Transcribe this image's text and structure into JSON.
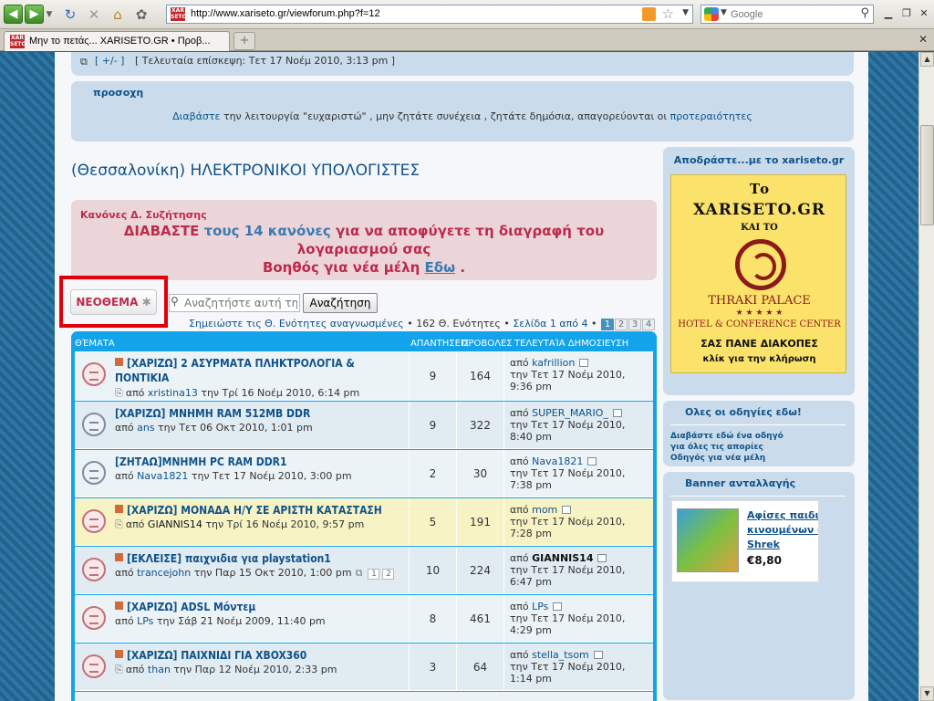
{
  "browser": {
    "url": "http://www.xariseto.gr/viewforum.php?f=12",
    "search_placeholder": "Google",
    "tab_title": "Μην το πετάς... XARISETO.GR • Προβ..."
  },
  "topbar": {
    "toggle": "[ +/- ]",
    "last_visit": "[ Τελευταία επίσκεψη: Τετ 17 Νοέμ 2010, 3:13 pm ]"
  },
  "notice": {
    "title": "προσοχη",
    "link1": "Διαβάστε",
    "middle": " την λειτουργία \"ευχαριστώ\" , μην ζητάτε συνέχεια , ζητάτε δημόσια, απαγορεύονται οι ",
    "link2": "προτεραιότητες"
  },
  "forum_title": "(Θεσσαλονίκη) ΗΛΕΚΤΡΟΝΙΚΟΙ ΥΠΟΛΟΓΙΣΤΕΣ",
  "rules": {
    "heading": "Κανόνες Δ. Συζήτησης",
    "l1a": "ΔΙΑΒΑΣΤΕ ",
    "l1link": "τους 14 κανόνες",
    "l1b": " για να αποφύγετε τη διαγραφή του",
    "l2": "λογαριασμού σας",
    "l3a": "Βοηθός για νέα μέλη ",
    "l3link": "Εδω",
    "l3b": " ."
  },
  "new_topic": {
    "a": "ΝΕΟ",
    "b": "ΘΕΜΑ",
    "star": "✱"
  },
  "forum_search": {
    "placeholder": "Αναζητήστε αυτή τη",
    "button": "Αναζήτηση"
  },
  "pagination": {
    "mark_read": "Σημειώστε τις Θ. Ενότητες αναγνωσμένες",
    "count": " • 162 Θ. Ενότητες • ",
    "page_info": "Σελίδα 1 από 4",
    "sep": " • ",
    "pages": [
      "1",
      "2",
      "3",
      "4"
    ]
  },
  "table_header": {
    "topics": "ΘΈΜΑΤΑ",
    "replies": "ΑΠΑΝΤΗΣΕΙΣ",
    "views": "ΠΡΟΒΟΛΕΣ",
    "last": "ΤΕΛΕΥΤΑΊΑ ΔΗΜΟΣΙΕΥΣΗ"
  },
  "topics": [
    {
      "title": "[ΧΑΡΙΖΩ] 2 ΑΣΥΡΜΑΤΑ ΠΛΗΚΤΡΟΛΟΓΙΑ & ΠΟΝΤΙΚΙΑ",
      "by_prefix": "από ",
      "author": "xristina13",
      "date": " την Τρί 16 Νοέμ 2010, 6:14 pm",
      "replies": "9",
      "views": "164",
      "last_prefix": "από ",
      "last_user": "kafrillion",
      "last_date1": "την Τετ 17 Νοέμ 2010,",
      "last_date2": "9:36 pm"
    },
    {
      "title": "[ΧΑΡΙΖΩ] ΜΝΗΜΗ RAM 512MB DDR",
      "by_prefix": "από ",
      "author": "ans",
      "date": " την Τετ 06 Οκτ 2010, 1:01 pm",
      "replies": "9",
      "views": "322",
      "last_prefix": "από ",
      "last_user": "SUPER_MARIO_",
      "last_date1": "την Τετ 17 Νοέμ 2010,",
      "last_date2": "8:40 pm"
    },
    {
      "title": "[ΖΗΤΑΩ]ΜΝΗΜΗ PC RAM DDR1",
      "by_prefix": "από ",
      "author": "Nava1821",
      "date": " την Τετ 17 Νοέμ 2010, 3:00 pm",
      "replies": "2",
      "views": "30",
      "last_prefix": "από ",
      "last_user": "Nava1821",
      "last_date1": "την Τετ 17 Νοέμ 2010,",
      "last_date2": "7:38 pm"
    },
    {
      "title": "[ΧΑΡΙΖΩ] ΜΟΝΑΔΑ Η/Υ ΣΕ ΑΡΙΣΤΗ ΚΑΤΑΣΤΑΣΗ",
      "by_prefix": "από ",
      "author": "GIANNIS14",
      "date": " την Τρί 16 Νοέμ 2010, 9:57 pm",
      "replies": "5",
      "views": "191",
      "last_prefix": "από ",
      "last_user": "mom",
      "last_date1": "την Τετ 17 Νοέμ 2010,",
      "last_date2": "7:28 pm"
    },
    {
      "title": "[ΕΚΛΕΙΣΕ] παιχνιδια για playstation1",
      "by_prefix": "από ",
      "author": "trancejohn",
      "date": " την Παρ 15 Οκτ 2010, 1:00 pm",
      "replies": "10",
      "views": "224",
      "last_prefix": "από ",
      "last_user": "GIANNIS14",
      "last_date1": "την Τετ 17 Νοέμ 2010,",
      "last_date2": "6:47 pm",
      "mini_pages": [
        "1",
        "2"
      ]
    },
    {
      "title": "[ΧΑΡΙΖΩ] ADSL Μόντεμ",
      "by_prefix": "από ",
      "author": "LPs",
      "date": " την Σάβ 21 Νοέμ 2009, 11:40 pm",
      "replies": "8",
      "views": "461",
      "last_prefix": "από ",
      "last_user": "LPs",
      "last_date1": "την Τετ 17 Νοέμ 2010,",
      "last_date2": "4:29 pm"
    },
    {
      "title": "[ΧΑΡΙΖΩ] ΠΑΙΧΝΙΔΙ ΓΙΑ XBOX360",
      "by_prefix": "από ",
      "author": "than",
      "date": " την Παρ 12 Νοέμ 2010, 2:33 pm",
      "replies": "3",
      "views": "64",
      "last_prefix": "από ",
      "last_user": "stella_tsom",
      "last_date1": "την Τετ 17 Νοέμ 2010,",
      "last_date2": "1:14 pm"
    }
  ],
  "sidebar": {
    "box1_title": "Αποδράστε...με το xariseto.gr",
    "banner": {
      "l1": "Το",
      "l2": "XARISETO.GR",
      "l3": "ΚΑΙ ΤΟ",
      "l4": "THRAKI PALACE",
      "l5": "★ ★ ★ ★ ★",
      "l6": "HOTEL & CONFERENCE CENTER",
      "l7": "ΣΑΣ ΠΑΝΕ ΔΙΑΚΟΠΕΣ",
      "l8": "κλίκ για την κλήρωση"
    },
    "box2_title": "Ολες οι οδηγίες εδω!",
    "box2_links": [
      "Διαβάστε εδώ ένα οδηγό",
      "για όλες τις απορίες",
      "Οδηγός για νέα μέλη"
    ],
    "box3_title": "Banner ανταλλαγής",
    "ad": {
      "l1": "Αφίσες παιδικ",
      "l2": "κινουμένων σχ",
      "l3": "Shrek",
      "price": "€8,80"
    }
  }
}
